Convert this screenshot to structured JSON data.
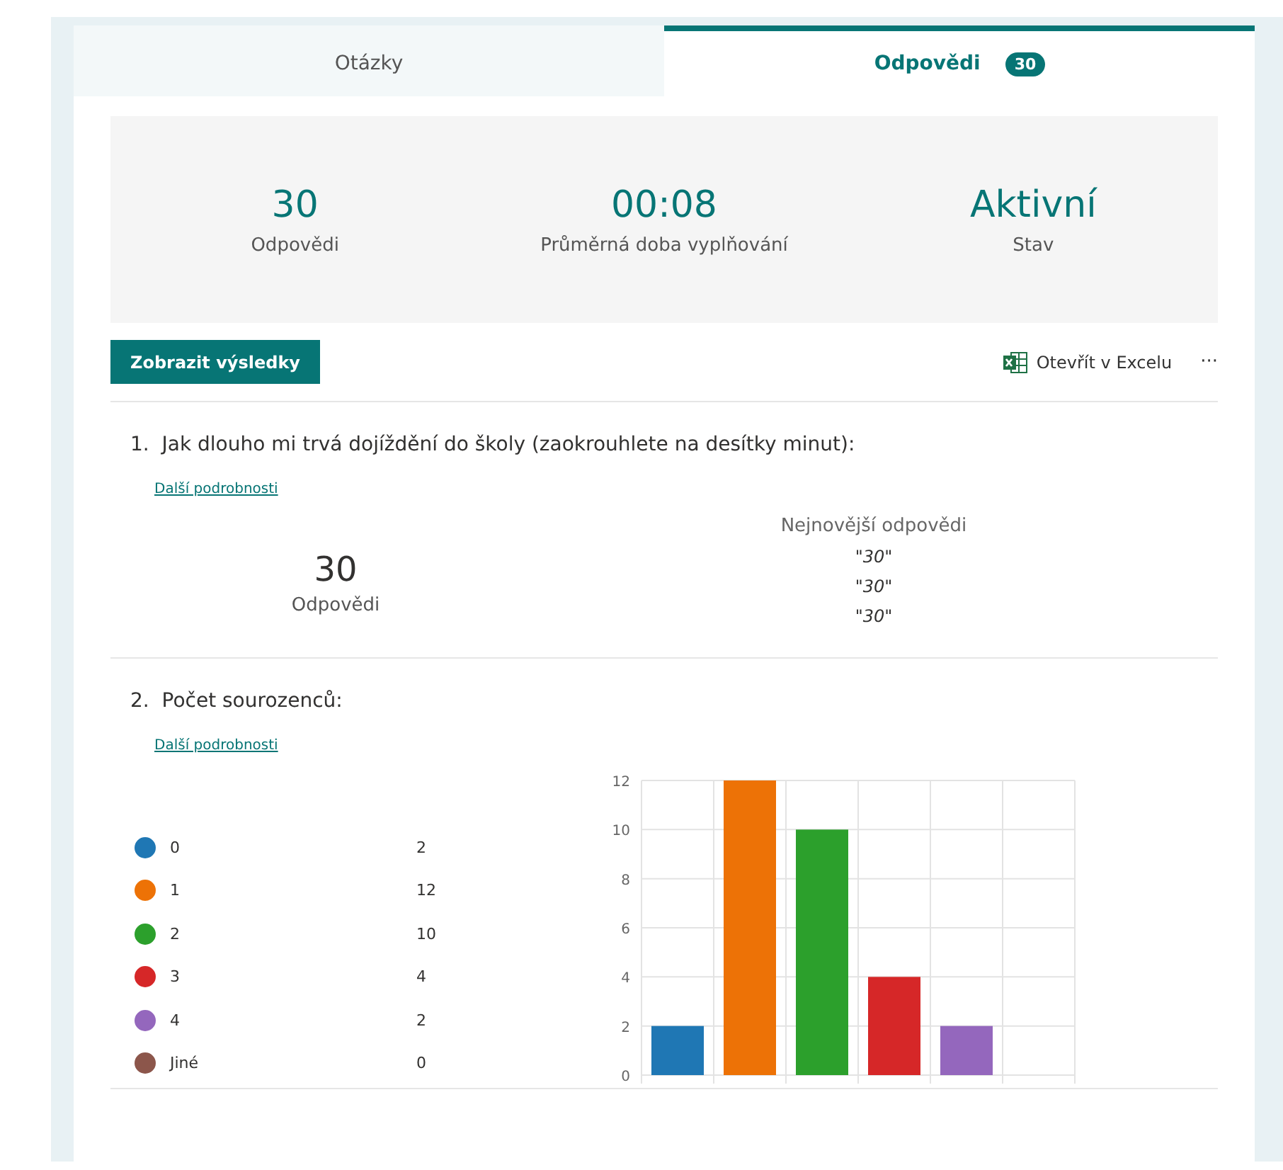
{
  "tabs": [
    {
      "label": "Otázky",
      "selected": false
    },
    {
      "label": "Odpovědi",
      "badge": "30",
      "selected": true
    }
  ],
  "summary": [
    {
      "value": "30",
      "label": "Odpovědi"
    },
    {
      "value": "00:08",
      "label": "Průměrná doba vyplňování"
    },
    {
      "value": "Aktivní",
      "label": "Stav"
    }
  ],
  "toolbar": {
    "view_button": "Zobrazit výsledky",
    "excel_link": "Otevřít v Excelu",
    "more": "···"
  },
  "questions": [
    {
      "kind": "text",
      "number": "1.",
      "title": "Jak dlouho mi trvá dojíždění do školy (zaokrouhlete na desítky minut):",
      "details_link": "Další podrobnosti",
      "count": "30",
      "count_label": "Odpovědi",
      "latest_title": "Nejnovější odpovědi",
      "latest": [
        "\"30\"",
        "\"30\"",
        "\"30\""
      ]
    },
    {
      "kind": "choice",
      "number": "2.",
      "title": "Počet sourozenců:",
      "details_link": "Další podrobnosti",
      "legend": [
        {
          "label": "0",
          "count": "2",
          "color": "#1f77b4"
        },
        {
          "label": "1",
          "count": "12",
          "color": "#ed7206"
        },
        {
          "label": "2",
          "count": "10",
          "color": "#2ca02c"
        },
        {
          "label": "3",
          "count": "4",
          "color": "#d62728"
        },
        {
          "label": "4",
          "count": "2",
          "color": "#9467bd"
        },
        {
          "label": "Jiné",
          "count": "0",
          "color": "#8c564b"
        }
      ],
      "chart_data": {
        "type": "bar",
        "grid": true,
        "values": [
          2,
          12,
          10,
          4,
          2,
          0
        ],
        "ylim": [
          0,
          12
        ],
        "yticks": [
          0,
          2,
          4,
          6,
          8,
          10,
          12
        ]
      }
    }
  ]
}
